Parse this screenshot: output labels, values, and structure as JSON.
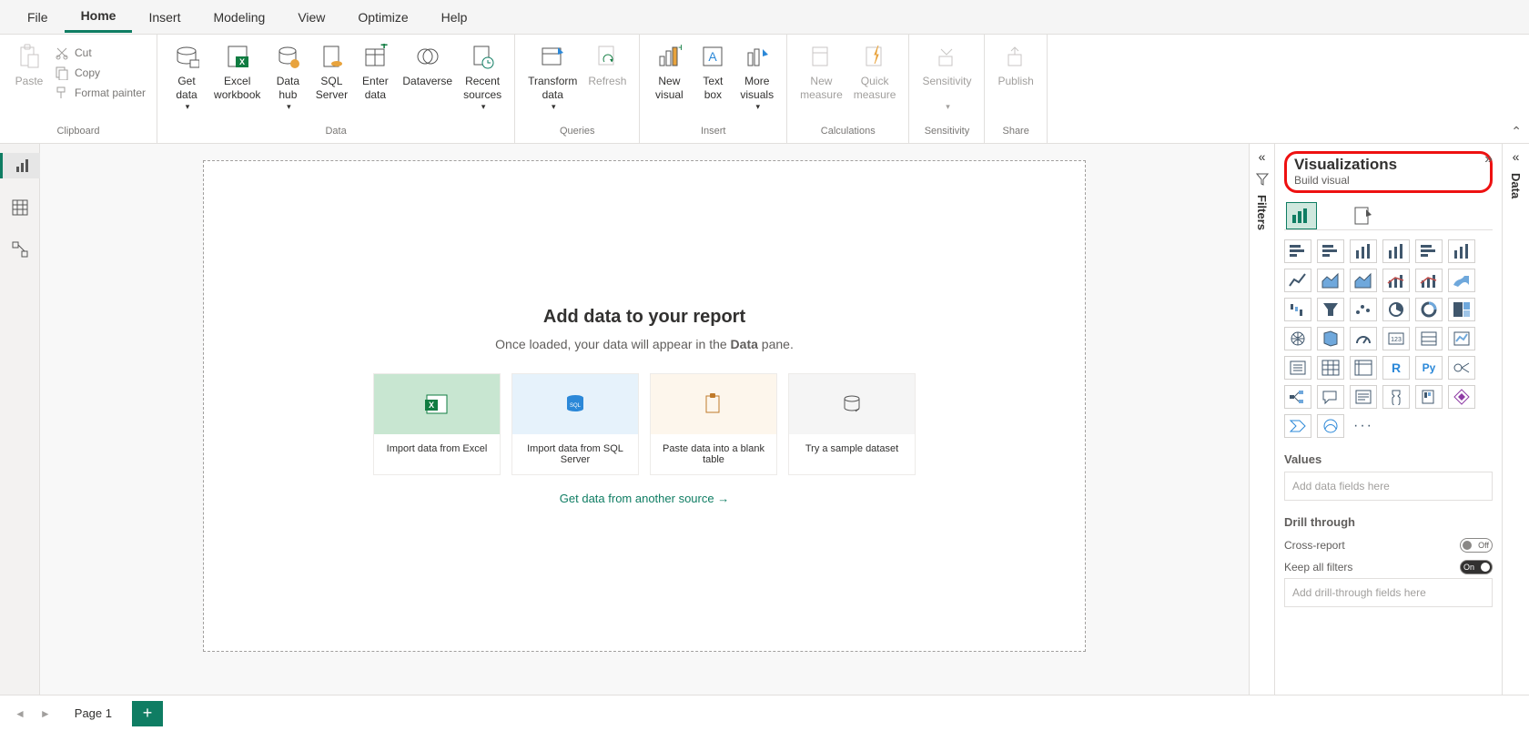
{
  "menu": {
    "items": [
      "File",
      "Home",
      "Insert",
      "Modeling",
      "View",
      "Optimize",
      "Help"
    ],
    "active_index": 1
  },
  "ribbon": {
    "clipboard": {
      "paste": "Paste",
      "cut": "Cut",
      "copy": "Copy",
      "format_painter": "Format painter",
      "group_label": "Clipboard"
    },
    "data": {
      "get_data": "Get\ndata",
      "excel_workbook": "Excel\nworkbook",
      "data_hub": "Data\nhub",
      "sql_server": "SQL\nServer",
      "enter_data": "Enter\ndata",
      "dataverse": "Dataverse",
      "recent_sources": "Recent\nsources",
      "group_label": "Data"
    },
    "queries": {
      "transform_data": "Transform\ndata",
      "refresh": "Refresh",
      "group_label": "Queries"
    },
    "insert": {
      "new_visual": "New\nvisual",
      "text_box": "Text\nbox",
      "more_visuals": "More\nvisuals",
      "group_label": "Insert"
    },
    "calculations": {
      "new_measure": "New\nmeasure",
      "quick_measure": "Quick\nmeasure",
      "group_label": "Calculations"
    },
    "sensitivity": {
      "sensitivity": "Sensitivity",
      "group_label": "Sensitivity"
    },
    "share": {
      "publish": "Publish",
      "group_label": "Share"
    }
  },
  "canvas": {
    "title": "Add data to your report",
    "subtitle_pre": "Once loaded, your data will appear in the ",
    "subtitle_bold": "Data",
    "subtitle_post": " pane.",
    "cards": [
      "Import data from Excel",
      "Import data from SQL Server",
      "Paste data into a blank table",
      "Try a sample dataset"
    ],
    "link": "Get data from another source →"
  },
  "filters_label": "Filters",
  "visualizations": {
    "title": "Visualizations",
    "subtitle": "Build visual",
    "values_label": "Values",
    "values_placeholder": "Add data fields here",
    "drill_label": "Drill through",
    "cross_report": "Cross-report",
    "cross_report_state": "Off",
    "keep_filters": "Keep all filters",
    "keep_filters_state": "On",
    "drill_placeholder": "Add drill-through fields here",
    "icons": [
      "stacked-bar",
      "clustered-bar",
      "stacked-column",
      "clustered-column",
      "100-bar",
      "100-column",
      "line",
      "area",
      "stacked-area",
      "line-stacked",
      "line-clustered",
      "ribbon",
      "waterfall",
      "funnel",
      "scatter",
      "pie",
      "donut",
      "treemap",
      "map",
      "filled-map",
      "gauge",
      "card",
      "multi-row-card",
      "kpi",
      "slicer",
      "table",
      "matrix",
      "r-visual",
      "python-visual",
      "key-influencers",
      "decomposition",
      "qna",
      "narrative",
      "goals",
      "paginated",
      "power-apps",
      "power-automate",
      "arcgis",
      "more-visuals"
    ],
    "icon_glyphs": {
      "r-visual": "R",
      "python-visual": "Py",
      "more-visuals": "···"
    }
  },
  "data_label": "Data",
  "footer": {
    "page": "Page 1"
  }
}
